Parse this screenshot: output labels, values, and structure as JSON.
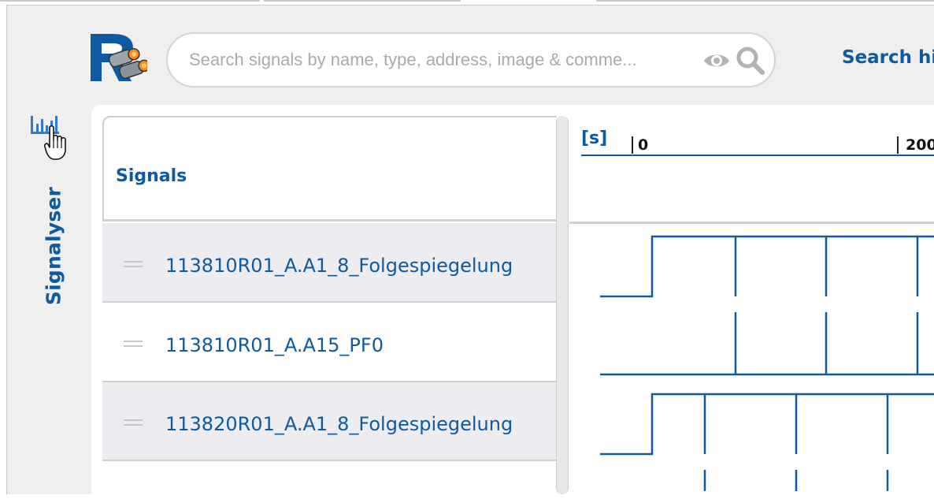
{
  "app": {
    "name": "Signalyser"
  },
  "search": {
    "placeholder": "Search signals by name, type, address, image & comme...",
    "history_label": "Search hi"
  },
  "icons": {
    "rail_chart": "bar-chart-icon",
    "cursor": "pointer-hand-icon",
    "logo": "binoculars-logo",
    "visibility": "eye-icon",
    "search": "magnifier-icon",
    "drag": "drag-handle-icon"
  },
  "table": {
    "header": "Signals",
    "rows": [
      {
        "label": "113810R01_A.A1_8_Folgespiegelung"
      },
      {
        "label": "113810R01_A.A15_PF0"
      },
      {
        "label": "113820R01_A.A1_8_Folgespiegelung"
      },
      {
        "label": ""
      }
    ]
  },
  "timeline": {
    "unit": "[s]",
    "ticks": [
      "0",
      "200"
    ]
  },
  "colors": {
    "accent": "#0e5aa0",
    "row_alt": "#ededf1",
    "background": "#efefef"
  }
}
